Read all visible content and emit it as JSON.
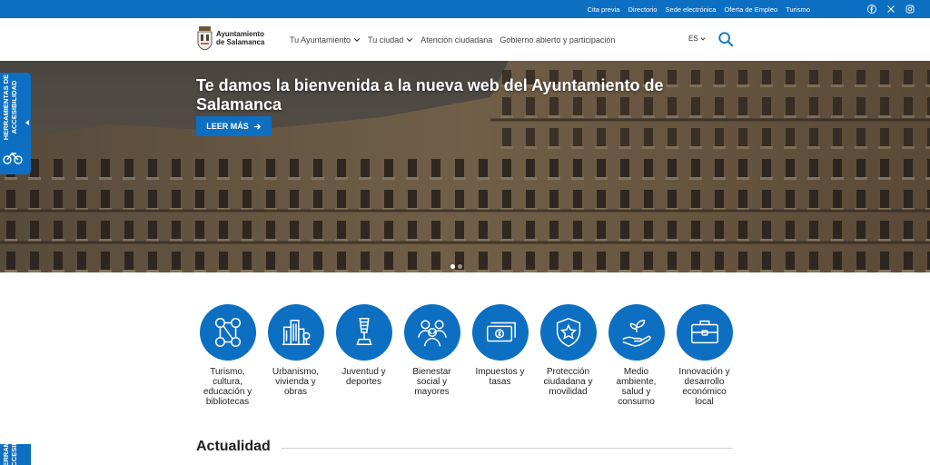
{
  "topbar": {
    "links": [
      "Cita previa",
      "Directorio",
      "Sede electrónica",
      "Oferta de Empleo",
      "Turismo"
    ],
    "social_icons": [
      "facebook-icon",
      "x-icon",
      "instagram-icon"
    ]
  },
  "header": {
    "logo_line1": "Ayuntamiento",
    "logo_line2": "de Salamanca",
    "nav": [
      {
        "label": "Tu Ayuntamiento",
        "has_menu": true
      },
      {
        "label": "Tu ciudad",
        "has_menu": true
      },
      {
        "label": "Atención ciudadana",
        "has_menu": false
      },
      {
        "label": "Gobierno abierto y participación",
        "has_menu": false
      }
    ],
    "language": "ES"
  },
  "hero": {
    "title": "Te damos la bienvenida a la nueva web del Ayuntamiento de Salamanca",
    "button_label": "LEER MÁS",
    "slide_count": 2,
    "active_slide": 1
  },
  "accessibility": {
    "label_line1": "HERRAMIENTAS DE",
    "label_line2": "ACCESIBILIDAD",
    "label2_line1": "HERRAMIENTAS DE",
    "label2_line2": "ACCESIBILIDAD"
  },
  "categories": [
    {
      "label": "Turismo, cultura, educación y bibliotecas",
      "icon": "culture-icon"
    },
    {
      "label": "Urbanismo, vivienda y obras",
      "icon": "city-icon"
    },
    {
      "label": "Juventud y deportes",
      "icon": "trophy-icon"
    },
    {
      "label": "Bienestar social y mayores",
      "icon": "people-icon"
    },
    {
      "label": "Impuestos y tasas",
      "icon": "money-icon"
    },
    {
      "label": "Protección ciudadana y movilidad",
      "icon": "shield-star-icon"
    },
    {
      "label": "Medio ambiente, salud y consumo",
      "icon": "plant-hand-icon"
    },
    {
      "label": "Innovación y desarrollo económico local",
      "icon": "briefcase-icon"
    }
  ],
  "news": {
    "heading": "Actualidad"
  },
  "colors": {
    "brand_blue": "#0d6fc1",
    "text": "#222222"
  }
}
